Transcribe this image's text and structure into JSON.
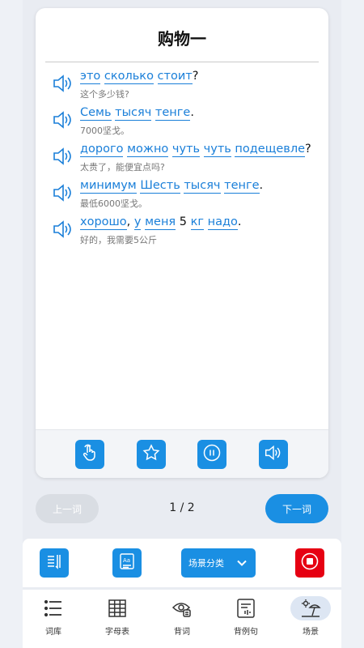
{
  "card": {
    "title": "购物一",
    "sentences": [
      {
        "parts": [
          {
            "t": "это",
            "w": true
          },
          {
            "t": " ",
            "w": false
          },
          {
            "t": "сколько",
            "w": true
          },
          {
            "t": " ",
            "w": false
          },
          {
            "t": "стоит",
            "w": true
          },
          {
            "t": "?",
            "w": false,
            "p": true
          }
        ],
        "translation": "这个多少钱?"
      },
      {
        "parts": [
          {
            "t": "Семь",
            "w": true
          },
          {
            "t": " ",
            "w": false
          },
          {
            "t": "тысяч",
            "w": true
          },
          {
            "t": " ",
            "w": false
          },
          {
            "t": "тенге",
            "w": true
          },
          {
            "t": ".",
            "w": false,
            "p": true
          }
        ],
        "translation": "7000坚戈。"
      },
      {
        "parts": [
          {
            "t": "дорого",
            "w": true
          },
          {
            "t": " ",
            "w": false
          },
          {
            "t": "можно",
            "w": true
          },
          {
            "t": " ",
            "w": false
          },
          {
            "t": "чуть",
            "w": true
          },
          {
            "t": " ",
            "w": false
          },
          {
            "t": "чуть",
            "w": true
          },
          {
            "t": " ",
            "w": false
          },
          {
            "t": "подещевле",
            "w": true
          },
          {
            "t": "?",
            "w": false,
            "p": true
          }
        ],
        "translation": "太贵了，能便宜点吗?"
      },
      {
        "parts": [
          {
            "t": "минимум",
            "w": true
          },
          {
            "t": " ",
            "w": false
          },
          {
            "t": "Шесть",
            "w": true
          },
          {
            "t": " ",
            "w": false
          },
          {
            "t": "тысяч",
            "w": true
          },
          {
            "t": " ",
            "w": false
          },
          {
            "t": "тенге",
            "w": true
          },
          {
            "t": ".",
            "w": false,
            "p": true
          }
        ],
        "translation": "最低6000坚戈。"
      },
      {
        "parts": [
          {
            "t": "хорошо",
            "w": true
          },
          {
            "t": ", ",
            "w": false,
            "p": true
          },
          {
            "t": "у",
            "w": true
          },
          {
            "t": " ",
            "w": false
          },
          {
            "t": "меня",
            "w": true
          },
          {
            "t": " 5 ",
            "w": false,
            "p": true
          },
          {
            "t": "кг",
            "w": true
          },
          {
            "t": " ",
            "w": false
          },
          {
            "t": "надо",
            "w": true
          },
          {
            "t": ".",
            "w": false,
            "p": true
          }
        ],
        "translation": "好的，我需要5公斤"
      }
    ],
    "controls": [
      "hand-tap-icon",
      "star-icon",
      "pause-icon",
      "speaker-icon"
    ]
  },
  "pager": {
    "prev_label": "上一词",
    "page": "1 / 2",
    "next_label": "下一词"
  },
  "toolbar": {
    "category_label": "场景分类"
  },
  "tabs": [
    {
      "label": "词库",
      "icon": "list-icon"
    },
    {
      "label": "字母表",
      "icon": "grid-table-icon"
    },
    {
      "label": "背词",
      "icon": "eye-memorize-icon"
    },
    {
      "label": "背例句",
      "icon": "sentence-card-icon"
    },
    {
      "label": "场景",
      "icon": "beach-scene-icon",
      "active": true
    }
  ],
  "colors": {
    "accent": "#1a8fe3",
    "link": "#1a7fd9",
    "stop": "#e60012",
    "disabled": "#d9dde3"
  }
}
